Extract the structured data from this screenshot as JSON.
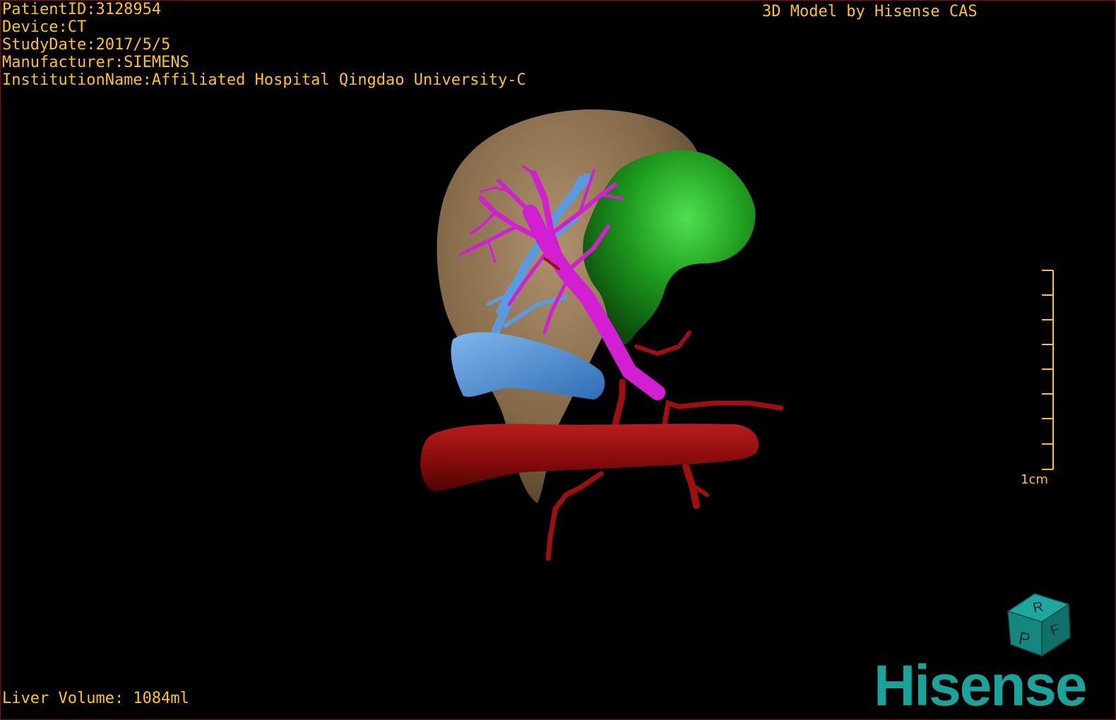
{
  "header": {
    "patient_id": "PatientID:3128954",
    "device": "Device:CT",
    "study_date": "StudyDate:2017/5/5",
    "manufacturer": "Manufacturer:SIEMENS",
    "institution": "InstitutionName:Affiliated Hospital Qingdao University-C",
    "credit": "3D Model by Hisense CAS"
  },
  "footer": {
    "liver_volume": "Liver Volume: 1084ml",
    "brand": "Hisense"
  },
  "scale_bar": {
    "label": "1cm"
  },
  "orientation_cube": {
    "top_face_letter": "R",
    "front_face_letter": "P",
    "side_face_letter": "F"
  },
  "colors": {
    "overlay_text": "#ffc21a",
    "liver": "#8a6e4c",
    "portal_vein": "#d41fd4",
    "hepatic_vein": "#4a8fd8",
    "artery": "#9a0f0f",
    "spleen_tumor": "#1f9a1f",
    "brand": "#1aa39a",
    "cube": "#1a8f8a"
  }
}
